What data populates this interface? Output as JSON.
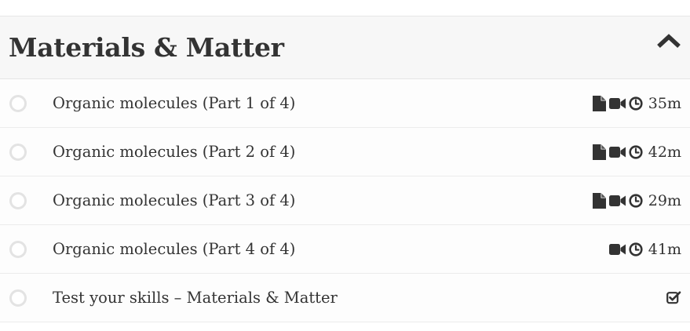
{
  "section": {
    "title": "Materials & Matter",
    "expanded": true,
    "lessons": [
      {
        "title": "Organic molecules (Part 1 of 4)",
        "icons": [
          "document-icon",
          "video-icon",
          "clock-icon"
        ],
        "duration": "35m"
      },
      {
        "title": "Organic molecules (Part 2 of 4)",
        "icons": [
          "document-icon",
          "video-icon",
          "clock-icon"
        ],
        "duration": "42m"
      },
      {
        "title": "Organic molecules (Part 3 of 4)",
        "icons": [
          "document-icon",
          "video-icon",
          "clock-icon"
        ],
        "duration": "29m"
      },
      {
        "title": "Organic molecules (Part 4 of 4)",
        "icons": [
          "video-icon",
          "clock-icon"
        ],
        "duration": "41m"
      },
      {
        "title": "Test your skills – Materials & Matter",
        "icons": [
          "checkbox-icon"
        ],
        "duration": ""
      }
    ]
  },
  "colors": {
    "text": "#333333",
    "header_bg": "#f7f7f7",
    "circle_border": "#e3e3e3",
    "divider": "#ececec"
  }
}
